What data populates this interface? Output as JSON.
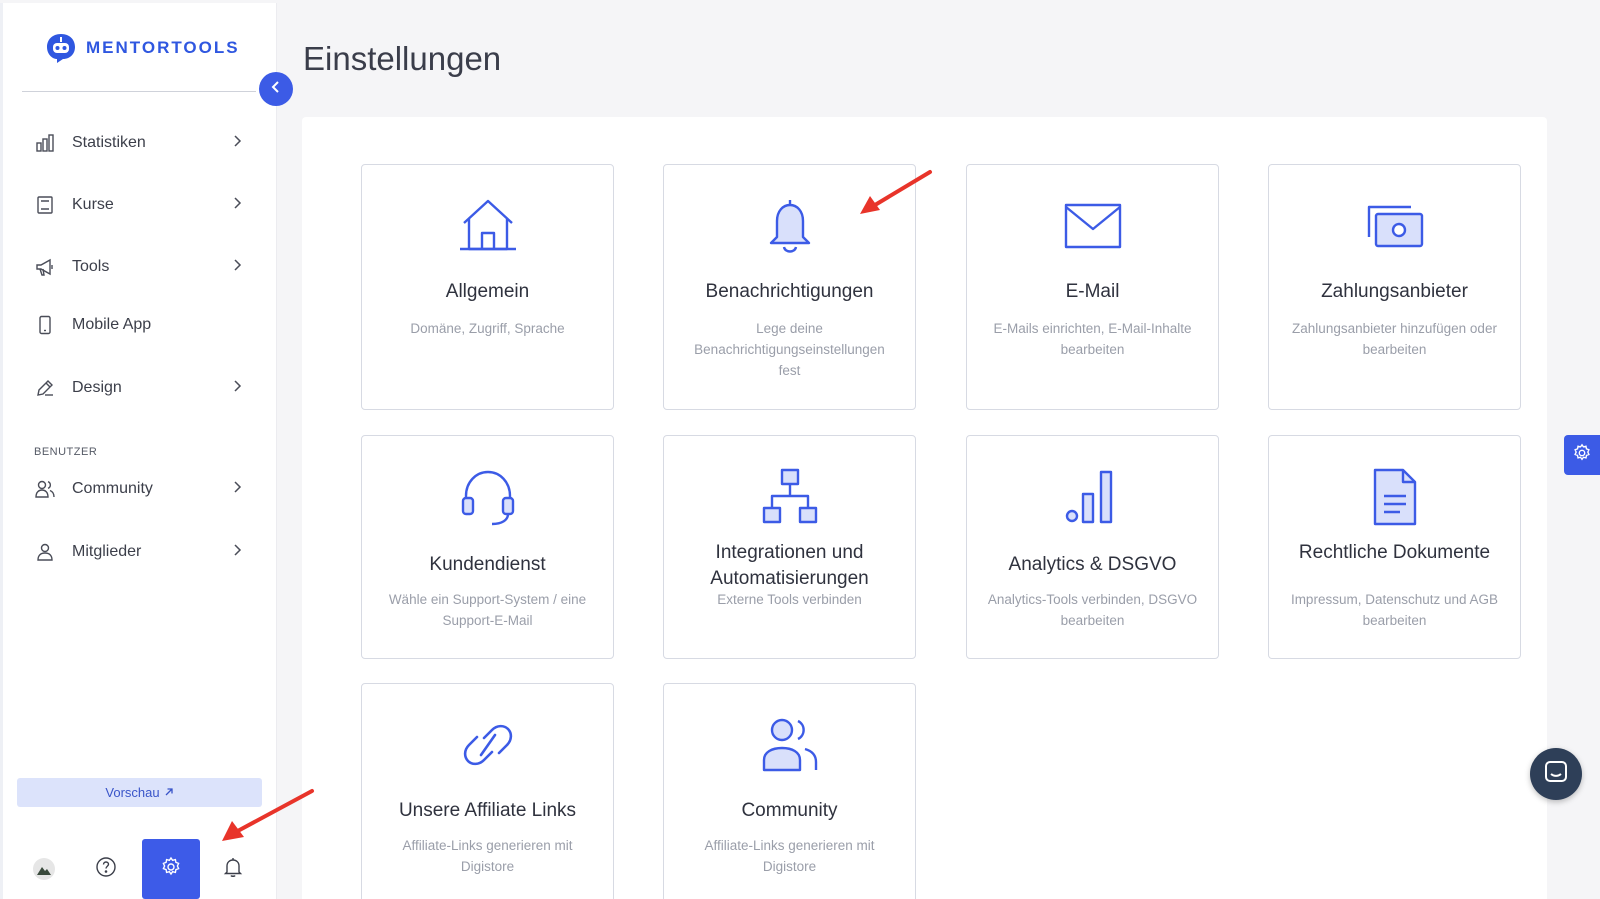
{
  "brand": {
    "name": "MENTORTOOLS",
    "accent": "#3c5be6",
    "arrow_color": "#e8342a"
  },
  "sidebar": {
    "items": [
      {
        "label": "Statistiken",
        "icon": "bar-chart-icon",
        "has_chevron": true
      },
      {
        "label": "Kurse",
        "icon": "book-icon",
        "has_chevron": true
      },
      {
        "label": "Tools",
        "icon": "megaphone-icon",
        "has_chevron": true
      },
      {
        "label": "Mobile App",
        "icon": "smartphone-icon",
        "has_chevron": false
      },
      {
        "label": "Design",
        "icon": "pencil-icon",
        "has_chevron": true
      }
    ],
    "section_label": "BENUTZER",
    "user_items": [
      {
        "label": "Community",
        "icon": "users-icon",
        "has_chevron": true
      },
      {
        "label": "Mitglieder",
        "icon": "user-icon",
        "has_chevron": true
      }
    ],
    "preview_label": "Vorschau",
    "bottom": [
      "avatar",
      "help-icon",
      "gear-icon",
      "bell-icon"
    ]
  },
  "main": {
    "title": "Einstellungen",
    "cards": [
      {
        "title": "Allgemein",
        "desc": "Domäne, Zugriff, Sprache",
        "icon": "home-icon"
      },
      {
        "title": "Benachrichtigungen",
        "desc": "Lege deine Benachrichtigungseinstellungen fest",
        "icon": "bell-icon"
      },
      {
        "title": "E-Mail",
        "desc": "E-Mails einrichten, E-Mail-Inhalte bearbeiten",
        "icon": "mail-icon"
      },
      {
        "title": "Zahlungsanbieter",
        "desc": "Zahlungsanbieter hinzufügen oder bearbeiten",
        "icon": "cash-icon"
      },
      {
        "title": "Kundendienst",
        "desc": "Wähle ein Support-System / eine Support-E-Mail",
        "icon": "headset-icon"
      },
      {
        "title": "Integrationen und Automatisierungen",
        "desc": "Externe Tools verbinden",
        "icon": "sitemap-icon"
      },
      {
        "title": "Analytics & DSGVO",
        "desc": "Analytics-Tools verbinden, DSGVO bearbeiten",
        "icon": "analytics-icon"
      },
      {
        "title": "Rechtliche Dokumente",
        "desc": "Impressum, Datenschutz und AGB bearbeiten",
        "icon": "document-icon"
      },
      {
        "title": "Unsere Affiliate Links",
        "desc": "Affiliate-Links generieren mit Digistore",
        "icon": "link-icon"
      },
      {
        "title": "Community",
        "desc": "Affiliate-Links generieren mit Digistore",
        "icon": "community-icon"
      }
    ]
  }
}
